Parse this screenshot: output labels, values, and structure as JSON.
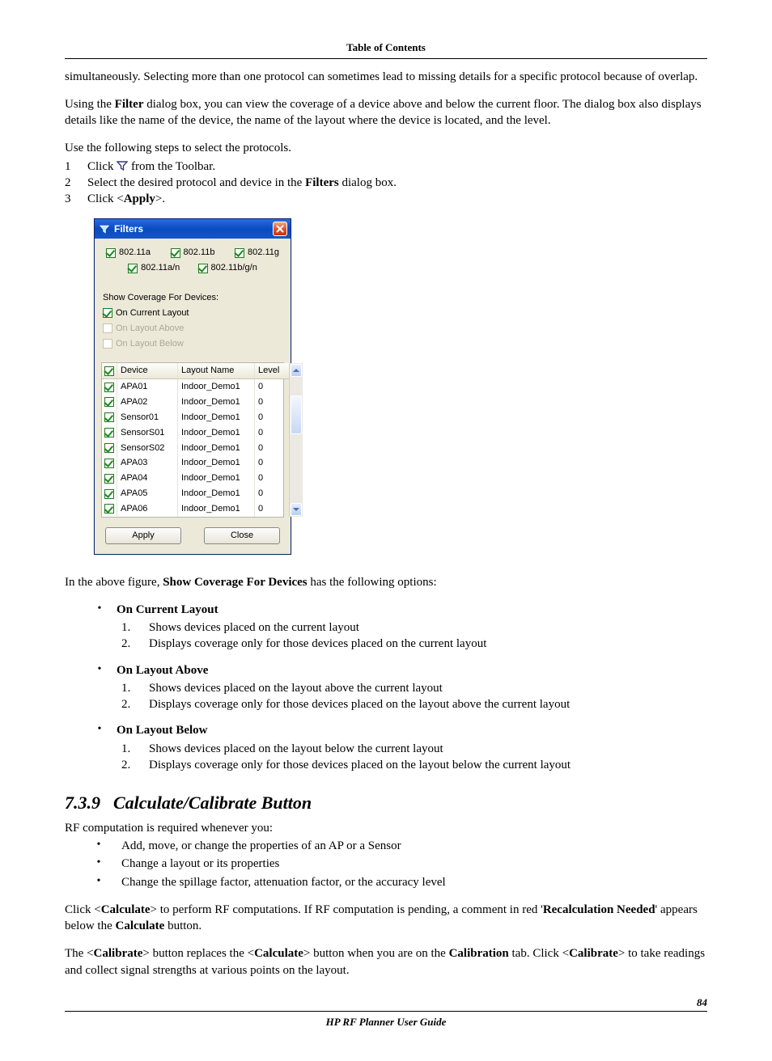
{
  "header": {
    "toc": "Table of Contents"
  },
  "para": {
    "p1a": "simultaneously. Selecting more than one protocol can sometimes lead to missing details for a specific protocol because of overlap.",
    "p2a": "Using the ",
    "p2b": "Filter",
    "p2c": " dialog box, you can view the coverage of a device above and below the current floor. The dialog box also displays details like the name of the device, the name of the layout where the device is located, and the level.",
    "p3": "Use the following steps to select the protocols."
  },
  "steps": {
    "1": {
      "n": "1",
      "a": "Click ",
      "b": " from the Toolbar."
    },
    "2": {
      "n": "2",
      "a": "Select the desired protocol and device in the ",
      "b": "Filters",
      "c": " dialog box."
    },
    "3": {
      "n": "3",
      "a": "Click <",
      "b": "Apply",
      "c": ">."
    }
  },
  "dialog": {
    "title": "Filters",
    "protocols": {
      "a": "802.11a",
      "b": "802.11b",
      "g": "802.11g",
      "an": "802.11a/n",
      "bgn": "802.11b/g/n"
    },
    "coverage_label": "Show Coverage For Devices:",
    "ocl": "On Current Layout",
    "ola": "On Layout Above",
    "olb": "On Layout Below",
    "cols": {
      "device": "Device",
      "layout": "Layout Name",
      "level": "Level"
    },
    "rows": [
      {
        "d": "APA01",
        "l": "Indoor_Demo1",
        "v": "0"
      },
      {
        "d": "APA02",
        "l": "Indoor_Demo1",
        "v": "0"
      },
      {
        "d": "Sensor01",
        "l": "Indoor_Demo1",
        "v": "0"
      },
      {
        "d": "SensorS01",
        "l": "Indoor_Demo1",
        "v": "0"
      },
      {
        "d": "SensorS02",
        "l": "Indoor_Demo1",
        "v": "0"
      },
      {
        "d": "APA03",
        "l": "Indoor_Demo1",
        "v": "0"
      },
      {
        "d": "APA04",
        "l": "Indoor_Demo1",
        "v": "0"
      },
      {
        "d": "APA05",
        "l": "Indoor_Demo1",
        "v": "0"
      },
      {
        "d": "APA06",
        "l": "Indoor_Demo1",
        "v": "0"
      }
    ],
    "apply": "Apply",
    "close": "Close"
  },
  "after": {
    "intro_a": "In the above figure, ",
    "intro_b": "Show Coverage For Devices",
    "intro_c": " has the following options:",
    "opts": [
      {
        "title": "On Current Layout",
        "items": [
          "Shows devices placed on the current layout",
          "Displays coverage only for those devices placed on the current layout"
        ]
      },
      {
        "title": "On Layout Above",
        "items": [
          "Shows devices placed on the layout above the current layout",
          "Displays coverage only for those devices placed on the layout above the current layout"
        ]
      },
      {
        "title": "On Layout Below",
        "items": [
          "Shows devices placed on the layout below the current layout",
          "Displays coverage only for those devices placed on the layout below the current layout"
        ]
      }
    ]
  },
  "section": {
    "num": "7.3.9",
    "title": "Calculate/Calibrate Button",
    "lead": "RF computation is required whenever you:",
    "bullets": [
      "Add, move, or change the properties of an AP or a Sensor",
      "Change a layout or its properties",
      "Change the spillage factor, attenuation factor, or the accuracy level"
    ],
    "p1": {
      "a": "Click <",
      "b": "Calculate",
      "c": "> to perform RF computations. If RF computation is pending, a comment in red '",
      "d": "Recalculation Needed",
      "e": "' appears below the ",
      "f": "Calculate",
      "g": " button."
    },
    "p2": {
      "a": "The <",
      "b": "Calibrate",
      "c": "> button replaces the <",
      "d": "Calculate",
      "e": "> button when you are on the ",
      "f": "Calibration",
      "g": " tab. Click <",
      "h": "Calibrate",
      "i": "> to take readings and collect signal strengths at various points on the layout."
    }
  },
  "footer": {
    "title": "HP RF Planner User Guide",
    "page": "84"
  }
}
